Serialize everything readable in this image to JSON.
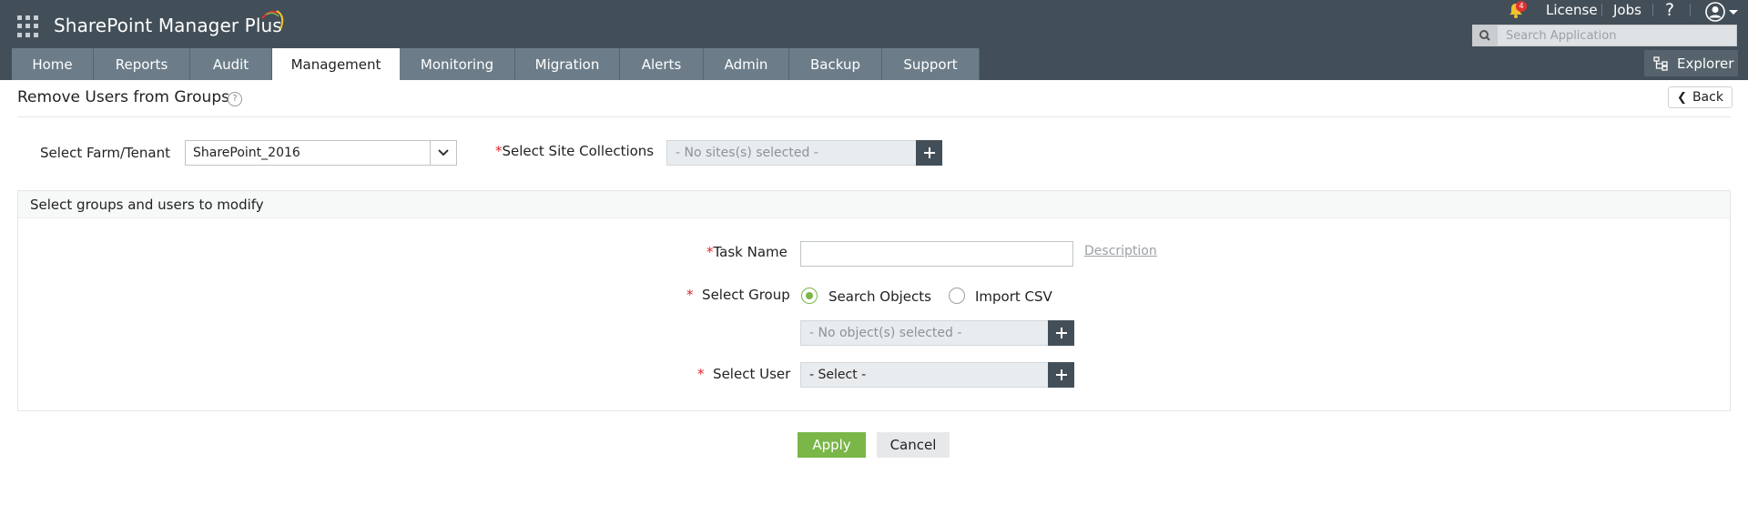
{
  "header": {
    "brand": "SharePoint Manager Plus",
    "notification_count": "4",
    "license_label": "License",
    "jobs_label": "Jobs",
    "help_label": "?",
    "search_placeholder": "Search Application",
    "explorer_label": "Explorer"
  },
  "nav": {
    "tabs": [
      {
        "label": "Home"
      },
      {
        "label": "Reports"
      },
      {
        "label": "Audit"
      },
      {
        "label": "Management",
        "active": true
      },
      {
        "label": "Monitoring"
      },
      {
        "label": "Migration"
      },
      {
        "label": "Alerts"
      },
      {
        "label": "Admin"
      },
      {
        "label": "Backup"
      },
      {
        "label": "Support"
      }
    ]
  },
  "page": {
    "title": "Remove Users from Groups",
    "title_help": "?",
    "back_label": "Back"
  },
  "form": {
    "farm_label": "Select Farm/Tenant",
    "farm_value": "SharePoint_2016",
    "site_label": "Select Site Collections",
    "site_value": "- No sites(s) selected -",
    "panel_title": "Select groups and users to modify",
    "task_label": "Task Name",
    "task_value": "",
    "description_link": "Description",
    "group_label": "Select Group",
    "radio_search": "Search Objects",
    "radio_import": "Import CSV",
    "selected_radio": "Search Objects",
    "objects_value": "- No object(s) selected -",
    "user_label": "Select User",
    "user_value": "- Select -",
    "required_mark": "*"
  },
  "actions": {
    "apply": "Apply",
    "cancel": "Cancel"
  },
  "colors": {
    "header_bg": "#434f58",
    "tab_bg": "#6c7d89",
    "accent_green": "#7ab648",
    "required_red": "#d9262c"
  }
}
